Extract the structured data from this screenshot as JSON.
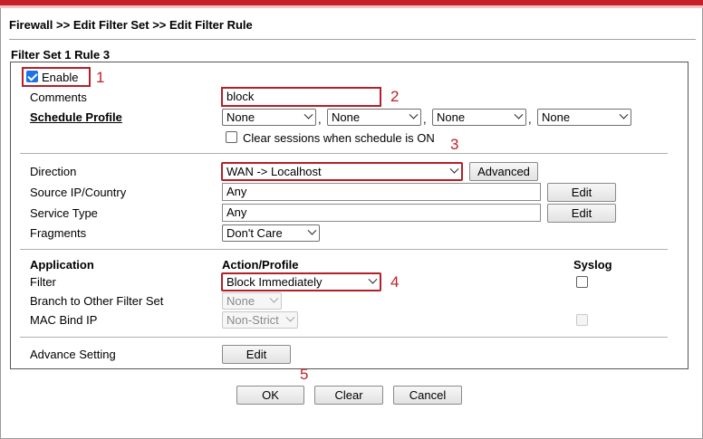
{
  "breadcrumb": "Firewall >> Edit Filter Set >> Edit Filter Rule",
  "set_title": "Filter Set 1 Rule 3",
  "enable": {
    "label": "Enable",
    "checked": true
  },
  "comments": {
    "label": "Comments",
    "value": "block"
  },
  "schedule": {
    "label": "Schedule Profile",
    "profiles": [
      "None",
      "None",
      "None",
      "None"
    ],
    "separator": ",",
    "clear_sessions_label": "Clear sessions when schedule is ON"
  },
  "direction": {
    "label": "Direction",
    "value": "WAN -> Localhost",
    "advanced_label": "Advanced"
  },
  "source": {
    "label": "Source IP/Country",
    "value": "Any",
    "edit_label": "Edit"
  },
  "service": {
    "label": "Service Type",
    "value": "Any",
    "edit_label": "Edit"
  },
  "fragments": {
    "label": "Fragments",
    "value": "Don't Care"
  },
  "headers": {
    "application": "Application",
    "action": "Action/Profile",
    "syslog": "Syslog"
  },
  "filter": {
    "label": "Filter",
    "value": "Block Immediately"
  },
  "branch": {
    "label": "Branch to Other Filter Set",
    "value": "None"
  },
  "macbind": {
    "label": "MAC Bind IP",
    "value": "Non-Strict"
  },
  "advance": {
    "label": "Advance Setting",
    "edit_label": "Edit"
  },
  "footer": {
    "ok": "OK",
    "clear": "Clear",
    "cancel": "Cancel"
  },
  "annotations": [
    "1",
    "2",
    "3",
    "4",
    "5"
  ],
  "colors": {
    "accent": "#c8202a",
    "highlight": "#b32028",
    "checkbox": "#1a73e8"
  }
}
